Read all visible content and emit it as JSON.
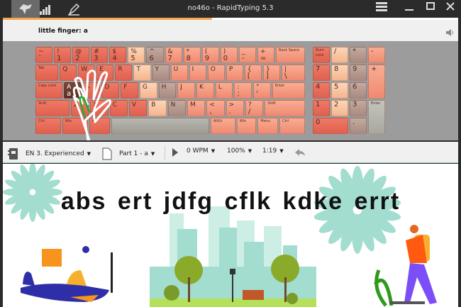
{
  "window": {
    "title": "no46o - RapidTyping 5.3"
  },
  "titlebar_icons": [
    "dragon-logo-icon",
    "statistics-icon",
    "editor-icon"
  ],
  "progress": {
    "percent": 46,
    "color": "#f5a64f"
  },
  "hint": {
    "text": "little finger: a"
  },
  "keyboard": {
    "rows": [
      [
        [
          "~",
          "`",
          "left"
        ],
        [
          "!",
          "1",
          "left"
        ],
        [
          "@",
          "2",
          "left"
        ],
        [
          "#",
          "3",
          "left"
        ],
        [
          "$",
          "4",
          "left"
        ],
        [
          "%",
          "5",
          "peach"
        ],
        [
          "^",
          "6",
          "grey"
        ],
        [
          "&",
          "7",
          "right"
        ],
        [
          "*",
          "8",
          "right"
        ],
        [
          "(",
          "9",
          "right"
        ],
        [
          ")",
          "0",
          "right"
        ],
        [
          "_",
          "-",
          "right"
        ],
        [
          "+",
          "=",
          "right"
        ],
        [
          "Back Space",
          "",
          "right"
        ]
      ],
      [
        [
          "Tab",
          "",
          "left"
        ],
        [
          "Q",
          "",
          "left"
        ],
        [
          "W",
          "",
          "left"
        ],
        [
          "E",
          "",
          "left"
        ],
        [
          "R",
          "",
          "left"
        ],
        [
          "T",
          "",
          "peach"
        ],
        [
          "Y",
          "",
          "grey"
        ],
        [
          "U",
          "",
          "right"
        ],
        [
          "I",
          "",
          "right"
        ],
        [
          "O",
          "",
          "right"
        ],
        [
          "P",
          "",
          "right"
        ],
        [
          "{",
          "[",
          "right"
        ],
        [
          "}",
          "]",
          "right"
        ],
        [
          "|",
          "\\",
          "right"
        ]
      ],
      [
        [
          "Caps Lock",
          "",
          "left"
        ],
        [
          "A",
          "a",
          "active"
        ],
        [
          "S",
          "",
          "left"
        ],
        [
          "D",
          "",
          "left"
        ],
        [
          "F",
          "",
          "left"
        ],
        [
          "G",
          "",
          "peach"
        ],
        [
          "H",
          "",
          "grey"
        ],
        [
          "J",
          "",
          "right"
        ],
        [
          "K",
          "",
          "right"
        ],
        [
          "L",
          "",
          "right"
        ],
        [
          ":",
          ";",
          "right"
        ],
        [
          "\"",
          "'",
          "right"
        ],
        [
          "Enter",
          "",
          "right"
        ]
      ],
      [
        [
          "Shift",
          "",
          "left"
        ],
        [
          "Z",
          "",
          "left"
        ],
        [
          "X",
          "",
          "left"
        ],
        [
          "C",
          "",
          "left"
        ],
        [
          "V",
          "",
          "left"
        ],
        [
          "B",
          "",
          "peach"
        ],
        [
          "N",
          "",
          "grey"
        ],
        [
          "M",
          "",
          "right"
        ],
        [
          "<",
          ",",
          "right"
        ],
        [
          ">",
          ".",
          "right"
        ],
        [
          "?",
          "/",
          "right"
        ],
        [
          "Shift",
          "",
          "right"
        ]
      ],
      [
        [
          "Ctrl",
          "",
          "left"
        ],
        [
          "Win",
          "",
          "left"
        ],
        [
          "Alt",
          "",
          "left"
        ],
        [
          "",
          "",
          "space"
        ],
        [
          "AltGr",
          "",
          "right"
        ],
        [
          "Win",
          "",
          "right"
        ],
        [
          "Menu",
          "",
          "right"
        ],
        [
          "Ctrl",
          "",
          "right"
        ]
      ]
    ],
    "numpad": [
      [
        "Num Lock",
        "left"
      ],
      [
        "/",
        "peach"
      ],
      [
        "*",
        "grey"
      ],
      [
        "-",
        "right"
      ],
      [
        "7",
        "left"
      ],
      [
        "8",
        "peach"
      ],
      [
        "9",
        "grey"
      ],
      [
        "+",
        "right"
      ],
      [
        "4",
        "left"
      ],
      [
        "5",
        "peach"
      ],
      [
        "6",
        "grey"
      ],
      [
        "1",
        "left"
      ],
      [
        "2",
        "peach"
      ],
      [
        "3",
        "grey"
      ],
      [
        "Enter",
        "enter"
      ],
      [
        "0",
        "left"
      ],
      [
        ".",
        "grey"
      ]
    ]
  },
  "toolbar": {
    "course": "EN 3. Experienced",
    "lesson": "Part 1 - a",
    "speed": "0 WPM",
    "zoom": "100%",
    "time": "1:19"
  },
  "lesson_text": "abs ert jdfg cflk kdke errt",
  "colors": {
    "teal": "#a3ddd0",
    "plane": "#2e2fa8",
    "orange": "#f7941d"
  }
}
